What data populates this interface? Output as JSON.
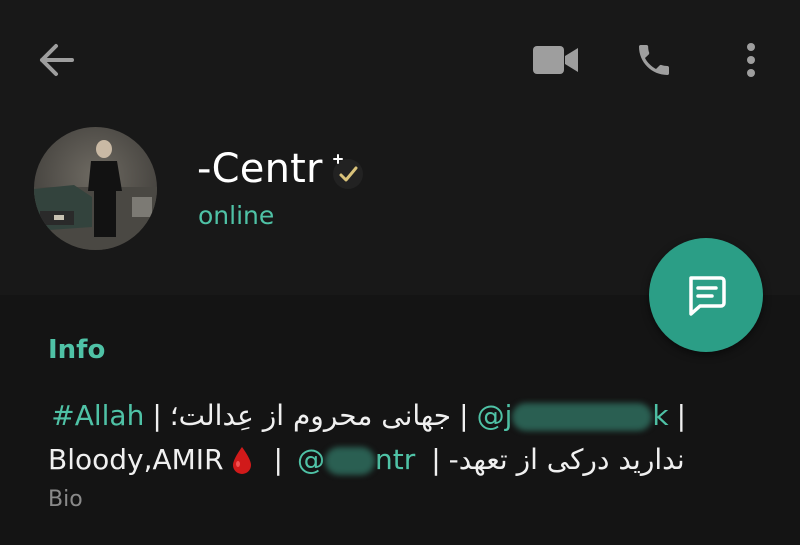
{
  "header": {
    "name": "-Centr",
    "status": "online"
  },
  "colors": {
    "accent": "#4fc2a6",
    "fab": "#2b9e86",
    "background": "#141414",
    "header_bg": "#181818"
  },
  "icons": {
    "back": "arrow-left-icon",
    "video": "video-camera-icon",
    "call": "phone-icon",
    "more": "more-vertical-icon",
    "badge": "verified-badge-icon",
    "fab": "message-icon"
  },
  "info": {
    "title": "Info",
    "bio_line1": {
      "separator_a": "|",
      "mention_prefix": "@j",
      "mention_suffix": "k",
      "separator_b": "|",
      "persian_text": "جهانی محروم از عِدالت؛",
      "separator_c": "|",
      "hashtag": "#Allah"
    },
    "bio_line2": {
      "text_a": "Bloody,AMIR",
      "drop": "🩸",
      "separator_a": "|",
      "mention_prefix": "@",
      "mention_suffix": "ntr",
      "separator_b": "|",
      "persian_text": "ندارید درکی از تعهد-"
    },
    "bio_label": "Bio"
  }
}
